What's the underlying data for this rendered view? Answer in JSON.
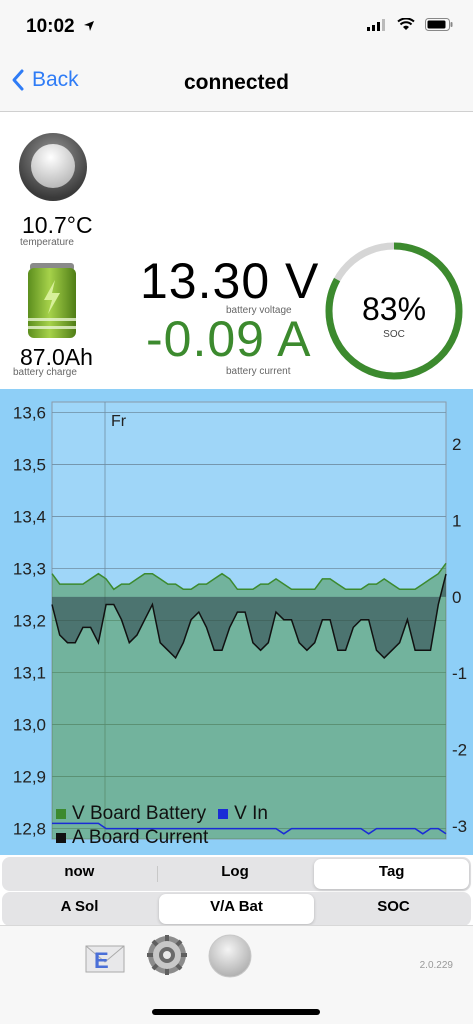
{
  "status": {
    "time": "10:02"
  },
  "nav": {
    "back_label": "Back",
    "title": "connected"
  },
  "readings": {
    "temperature_value": "10.7°C",
    "temperature_label": "temperature",
    "battery_charge_value": "87.0Ah",
    "battery_charge_label": "battery charge",
    "voltage_value": "13.30 V",
    "voltage_label": "battery voltage",
    "current_value": "-0.09 A",
    "current_label": "battery current",
    "soc_value": "83%",
    "soc_label": "SOC",
    "soc_fraction": 0.83
  },
  "colors": {
    "accent": "#2f7cf6",
    "green": "#3c8a2e",
    "chart_bg": "#8ecff7",
    "vin": "#1a2bd6"
  },
  "chart_data": {
    "type": "line",
    "annotations": [
      "Fr"
    ],
    "y_left": {
      "ticks": [
        "13,6",
        "13,5",
        "13,4",
        "13,3",
        "13,2",
        "13,1",
        "13,0",
        "12,9",
        "12,8"
      ],
      "range": [
        12.78,
        13.62
      ]
    },
    "y_right": {
      "ticks": [
        "2",
        "1",
        "0",
        "-1",
        "-2",
        "-3"
      ],
      "range": [
        -3.17,
        2.55
      ]
    },
    "series": [
      {
        "name": "V Board Battery",
        "axis": "left",
        "color": "#3c8a2e",
        "values": [
          13.29,
          13.27,
          13.27,
          13.27,
          13.27,
          13.28,
          13.29,
          13.28,
          13.26,
          13.27,
          13.27,
          13.28,
          13.29,
          13.29,
          13.28,
          13.27,
          13.27,
          13.26,
          13.26,
          13.27,
          13.27,
          13.28,
          13.29,
          13.28,
          13.26,
          13.26,
          13.26,
          13.27,
          13.27,
          13.28,
          13.27,
          13.26,
          13.26,
          13.26,
          13.26,
          13.28,
          13.28,
          13.27,
          13.26,
          13.26,
          13.26,
          13.27,
          13.27,
          13.28,
          13.27,
          13.26,
          13.26,
          13.26,
          13.27,
          13.28,
          13.29,
          13.31
        ]
      },
      {
        "name": "V In",
        "axis": "left",
        "color": "#1a2bd6",
        "values": [
          12.81,
          12.81,
          12.81,
          12.81,
          12.81,
          12.81,
          12.81,
          12.8,
          12.8,
          12.8,
          12.8,
          12.8,
          12.8,
          12.8,
          12.8,
          12.8,
          12.8,
          12.8,
          12.8,
          12.8,
          12.8,
          12.8,
          12.8,
          12.8,
          12.8,
          12.8,
          12.8,
          12.8,
          12.8,
          12.8,
          12.79,
          12.8,
          12.8,
          12.8,
          12.8,
          12.8,
          12.8,
          12.8,
          12.8,
          12.8,
          12.8,
          12.79,
          12.8,
          12.8,
          12.8,
          12.8,
          12.8,
          12.8,
          12.79,
          12.8,
          12.8,
          12.79
        ]
      },
      {
        "name": "A Board Current",
        "axis": "right",
        "color": "#111111",
        "values": [
          -0.1,
          -0.5,
          -0.6,
          -0.6,
          -0.4,
          -0.4,
          -0.6,
          -0.1,
          -0.1,
          -0.3,
          -0.6,
          -0.5,
          -0.3,
          -0.1,
          -0.6,
          -0.7,
          -0.8,
          -0.6,
          -0.3,
          -0.2,
          -0.4,
          -0.7,
          -0.7,
          -0.4,
          -0.2,
          -0.2,
          -0.6,
          -0.7,
          -0.6,
          -0.2,
          -0.3,
          -0.3,
          -0.6,
          -0.7,
          -0.6,
          -0.3,
          -0.3,
          -0.7,
          -0.7,
          -0.4,
          -0.3,
          -0.3,
          -0.7,
          -0.8,
          -0.7,
          -0.6,
          -0.3,
          -0.7,
          -0.7,
          -0.7,
          -0.1,
          0.3
        ]
      }
    ]
  },
  "legend": [
    {
      "label": "V Board Battery",
      "color": "#3c8a2e"
    },
    {
      "label": "V In",
      "color": "#1a2bd6"
    },
    {
      "label": "A Board Current",
      "color": "#111111"
    }
  ],
  "tabs_row1": [
    {
      "label": "now",
      "active": false
    },
    {
      "label": "Log",
      "active": false
    },
    {
      "label": "Tag",
      "active": true
    }
  ],
  "tabs_row2": [
    {
      "label": "A Sol",
      "active": false
    },
    {
      "label": "V/A Bat",
      "active": true
    },
    {
      "label": "SOC",
      "active": false
    }
  ],
  "toolbar": {
    "version": "2.0.229"
  }
}
